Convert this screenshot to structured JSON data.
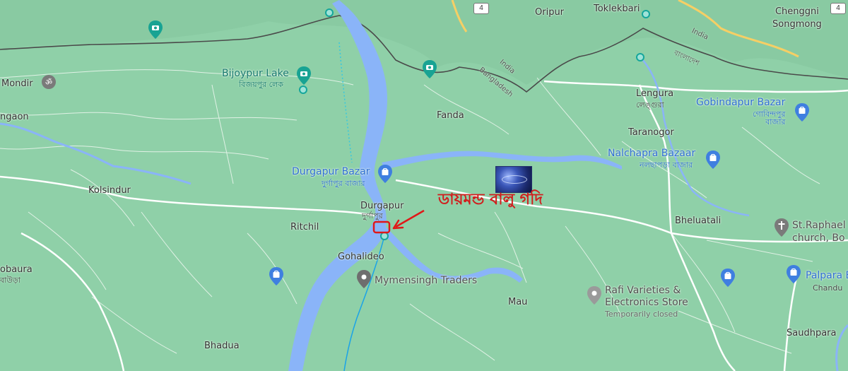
{
  "map": {
    "labels": {
      "oripur": "Oripur",
      "toklekbari": "Toklekbari",
      "chenggni_songmong": "Chenggni\nSongmong",
      "mondir": "Mondir",
      "ngaon": "ngaon",
      "bijoypur_lake": "Bijoypur Lake",
      "bijoypur_lake_bn": "বিজয়পুর লেক",
      "fanda": "Fanda",
      "lengura": "Lengura",
      "lengura_bn": "লেঙ্গুরা",
      "gobindapur_bazar": "Gobindapur Bazar",
      "gobindapur_bazar_bn": "গোবিন্দপুর\nবাজার",
      "taranogor": "Taranogor",
      "nalchapra_bazaar": "Nalchapra Bazaar",
      "nalchapra_bazaar_bn": "নলছাপড়া বাজার",
      "durgapur_bazar": "Durgapur Bazar",
      "durgapur_bazar_bn": "দুর্গাপুর বাজার",
      "kolsindur": "Kolsindur",
      "durgapur": "Durgapur",
      "durgapur_bn": "দুর্গাপুর",
      "ritchil": "Ritchil",
      "bheluatali": "Bheluatali",
      "st_raphael_church": "St.Raphael\nchurch, Bo",
      "gohalideo": "Gohalideo",
      "obaura": "obaura",
      "obaura_bn": "বাউড়া",
      "mymensingh_traders": "Mymensingh Traders",
      "palpara_bazar": "Palpara B",
      "chandu": "Chandu",
      "mau": "Mau",
      "rafi_varieties": "Rafi Varieties &\nElectronics Store",
      "temporarily_closed": "Temporarily closed",
      "bhadua": "Bhadua",
      "saudhpara": "Saudhpara",
      "india_1": "India",
      "bangladesh_1": "Bangladesh",
      "india_2": "India",
      "bangladesh_bn": "বাংলাদেশ"
    },
    "highway_shields": [
      "4",
      "4"
    ],
    "annotation": "ডায়মন্ড বালু গদি",
    "colors": {
      "land": "#8fd0a8",
      "water": "#8ab4f8",
      "road": "#ffffff",
      "highway": "#f6cf65",
      "border": "#4a4a4a",
      "annotation": "#d11d1d",
      "poi_blue": "#2f6fd3",
      "poi_teal": "#16796e"
    },
    "icons": [
      "camera-pin-icon",
      "shopping-bag-pin-icon",
      "cross-pin-icon",
      "location-pin-icon",
      "transit-dot-icon",
      "red-arrow-icon",
      "red-rectangle-marker"
    ]
  }
}
